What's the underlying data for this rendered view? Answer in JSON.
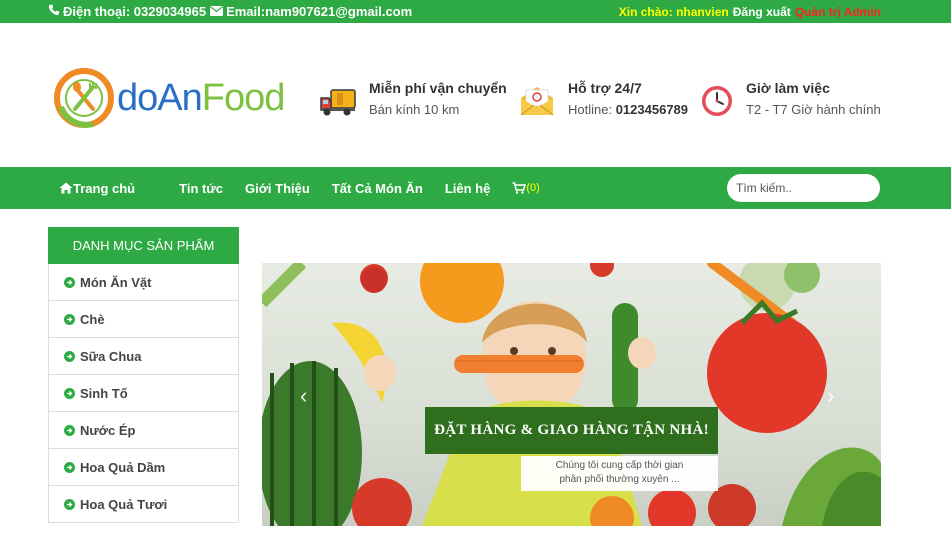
{
  "topbar": {
    "phone_label": "Điện thoại: 0329034965",
    "email_label": "Email:nam907621@gmail.com",
    "greeting": "Xin chào: nhanvien",
    "logout": "Đăng xuất",
    "admin": "Quản trị Admin"
  },
  "logo": {
    "part1": "doAn",
    "part2": "Food"
  },
  "features": [
    {
      "title": "Miễn phí vận chuyển",
      "subtitle": "Bán kính 10 km",
      "icon": "truck-icon"
    },
    {
      "title": "Hỗ trợ 24/7",
      "subtitle_label": "Hotline:",
      "subtitle_value": "0123456789",
      "icon": "email-icon"
    },
    {
      "title": "Giờ làm việc",
      "subtitle": "T2 - T7 Giờ hành chính",
      "icon": "clock-icon"
    }
  ],
  "nav": {
    "items": [
      "Trang chủ",
      "Tin tức",
      "Giới Thiệu",
      "Tất Cả Món Ăn",
      "Liên hệ"
    ],
    "cart_count": "(0)"
  },
  "search": {
    "placeholder": "Tìm kiếm.."
  },
  "sidebar": {
    "title": "DANH MỤC SẢN PHẨM",
    "items": [
      "Món Ăn Vặt",
      "Chè",
      "Sữa Chua",
      "Sinh Tố",
      "Nước Ép",
      "Hoa Quả Dầm",
      "Hoa Quả Tươi"
    ]
  },
  "banner": {
    "caption": "ĐẶT HÀNG & GIAO HÀNG TẬN NHÀ!",
    "subcaption_line1": "Chúng tôi cung cấp thời gian",
    "subcaption_line2": "phân phối thường xuyên ..."
  },
  "colors": {
    "primary": "#2eaa45",
    "caption_bg": "#2e6e1c",
    "greeting": "#ffff00",
    "admin": "#ff2020"
  }
}
